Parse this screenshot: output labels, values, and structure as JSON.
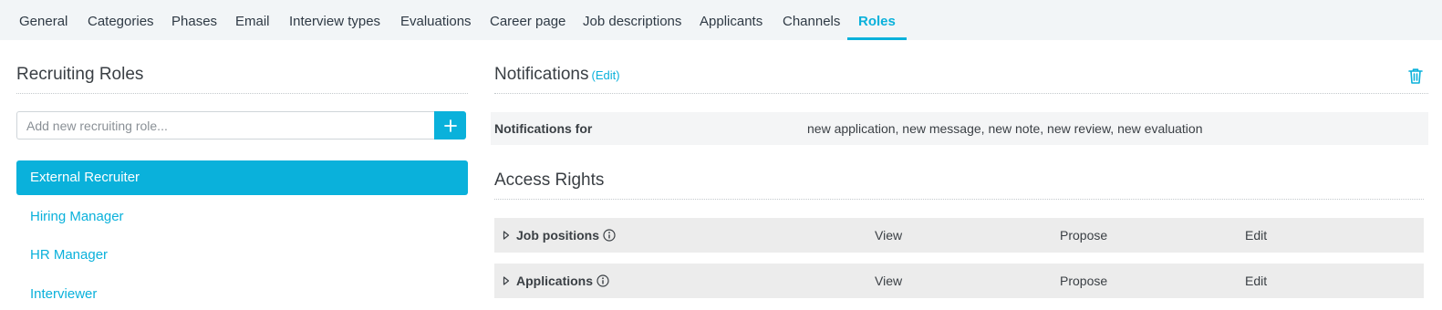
{
  "tabs": [
    {
      "label": "General"
    },
    {
      "label": "Categories"
    },
    {
      "label": "Phases"
    },
    {
      "label": "Email"
    },
    {
      "label": "Interview types"
    },
    {
      "label": "Evaluations"
    },
    {
      "label": "Career page"
    },
    {
      "label": "Job descriptions"
    },
    {
      "label": "Applicants"
    },
    {
      "label": "Channels"
    },
    {
      "label": "Roles",
      "active": true
    }
  ],
  "left": {
    "title": "Recruiting Roles",
    "input_placeholder": "Add new recruiting role...",
    "add_icon": "plus-icon",
    "roles": [
      {
        "label": "External Recruiter",
        "selected": true
      },
      {
        "label": "Hiring Manager"
      },
      {
        "label": "HR Manager"
      },
      {
        "label": "Interviewer"
      }
    ]
  },
  "notifications": {
    "title": "Notifications",
    "edit_label": "(Edit)",
    "row_label": "Notifications for",
    "row_value": "new application, new message, new note, new review, new evaluation",
    "delete_icon": "trash-icon"
  },
  "access": {
    "title": "Access Rights",
    "rows": [
      {
        "name": "Job positions",
        "perms": [
          "View",
          "Propose",
          "Edit"
        ]
      },
      {
        "name": "Applications",
        "perms": [
          "View",
          "Propose",
          "Edit"
        ]
      }
    ]
  },
  "colors": {
    "accent": "#0ab1db",
    "tabbar_bg": "#f2f5f7",
    "row_bg": "#ececec"
  }
}
